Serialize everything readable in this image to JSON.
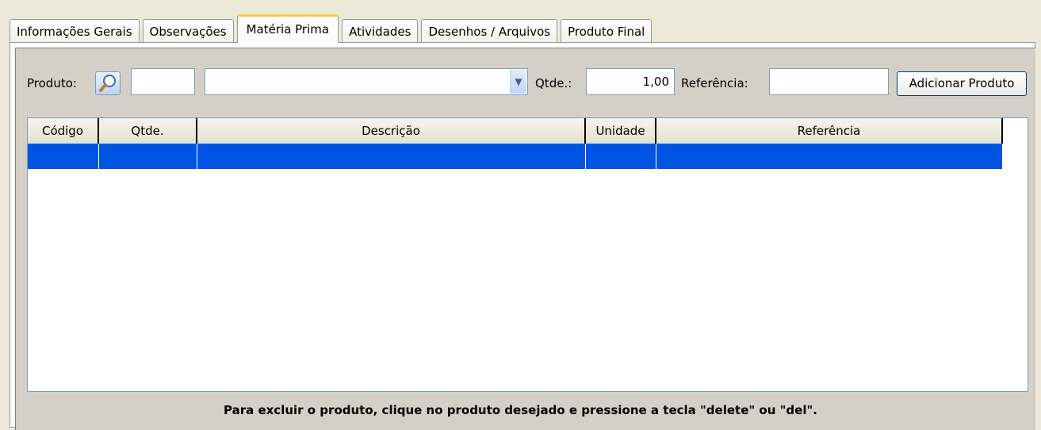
{
  "tabs": [
    {
      "label": "Informações Gerais",
      "active": false
    },
    {
      "label": "Observações",
      "active": false
    },
    {
      "label": "Matéria Prima",
      "active": true
    },
    {
      "label": "Atividades",
      "active": false
    },
    {
      "label": "Desenhos / Arquivos",
      "active": false
    },
    {
      "label": "Produto Final",
      "active": false
    }
  ],
  "form": {
    "produto_label": "Produto:",
    "produto_code_value": "",
    "produto_desc_value": "",
    "qtde_label": "Qtde.:",
    "qtde_value": "1,00",
    "referencia_label": "Referência:",
    "referencia_value": "",
    "add_button": "Adicionar Produto"
  },
  "grid": {
    "columns": [
      "Código",
      "Qtde.",
      "Descrição",
      "Unidade",
      "Referência"
    ],
    "rows": [
      [
        "",
        "",
        "",
        "",
        ""
      ]
    ],
    "selected_row_color": "#0054E3"
  },
  "footer": {
    "hint": "Para excluir o produto, clique no produto desejado e pressione a tecla \"delete\" ou \"del\"."
  },
  "colors": {
    "active_tab_accent": "#FFC83C",
    "window_bg": "#ECE9D8"
  }
}
